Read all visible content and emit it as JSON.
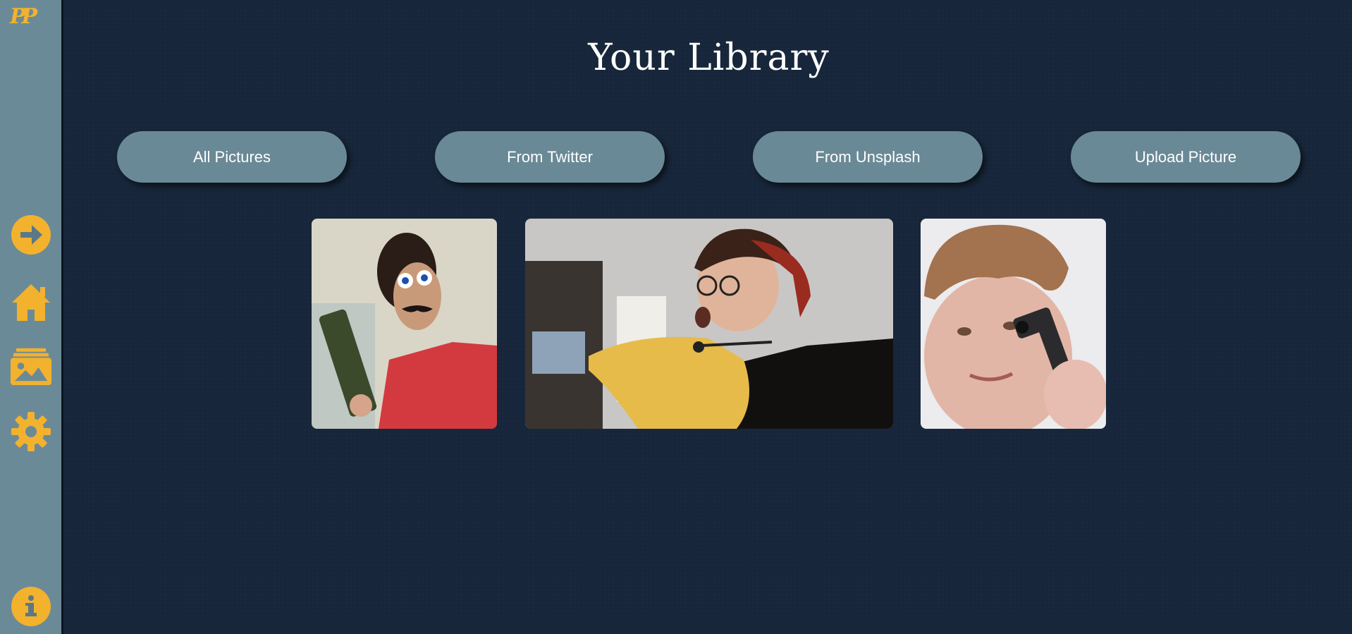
{
  "app": {
    "logo_text": "PP"
  },
  "colors": {
    "accent": "#f2b22e",
    "sidebar": "#6b8a98",
    "background": "#17263a",
    "button": "#6a8996"
  },
  "sidebar": {
    "items": [
      {
        "name": "login",
        "icon": "arrow-right-circle-icon"
      },
      {
        "name": "home",
        "icon": "home-icon"
      },
      {
        "name": "library",
        "icon": "gallery-icon"
      },
      {
        "name": "settings",
        "icon": "gear-icon"
      }
    ],
    "footer": {
      "name": "info",
      "icon": "info-icon"
    }
  },
  "main": {
    "title": "Your Library",
    "filters": [
      "All Pictures",
      "From Twitter",
      "From Unsplash",
      "Upload Picture"
    ],
    "pictures": [
      {
        "subject": "person with googly-eye glasses and toy gun"
      },
      {
        "subject": "person with headset pointing at screen"
      },
      {
        "subject": "person with curly hair holding toy pistol"
      }
    ]
  }
}
